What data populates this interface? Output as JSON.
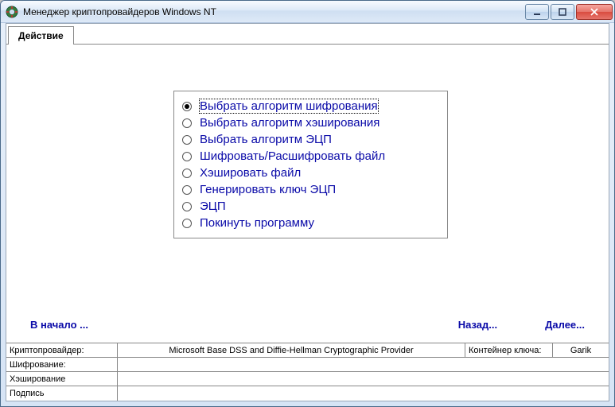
{
  "window": {
    "title": "Менеджер криптопровайдеров Windows NT"
  },
  "tabs": {
    "action": "Действие"
  },
  "options": [
    {
      "label": "Выбрать алгоритм шифрования",
      "selected": true
    },
    {
      "label": "Выбрать алгоритм хэширования",
      "selected": false
    },
    {
      "label": "Выбрать алгоритм ЭЦП",
      "selected": false
    },
    {
      "label": "Шифровать/Расшифровать файл",
      "selected": false
    },
    {
      "label": "Хэшировать файл",
      "selected": false
    },
    {
      "label": "Генерировать ключ ЭЦП",
      "selected": false
    },
    {
      "label": "ЭЦП",
      "selected": false
    },
    {
      "label": "Покинуть программу",
      "selected": false
    }
  ],
  "nav": {
    "start": "В начало ...",
    "back": "Назад...",
    "next": "Далее..."
  },
  "status": {
    "cryptoprovider_label": "Криптопровайдер:",
    "cryptoprovider_value": "Microsoft Base DSS and Diffie-Hellman Cryptographic Provider",
    "key_container_label": "Контейнер ключа:",
    "key_container_value": "Garik",
    "encryption_label": "Шифрование:",
    "encryption_value": "",
    "hashing_label": "Хэширование",
    "hashing_value": "",
    "signature_label": "Подпись",
    "signature_value": ""
  }
}
